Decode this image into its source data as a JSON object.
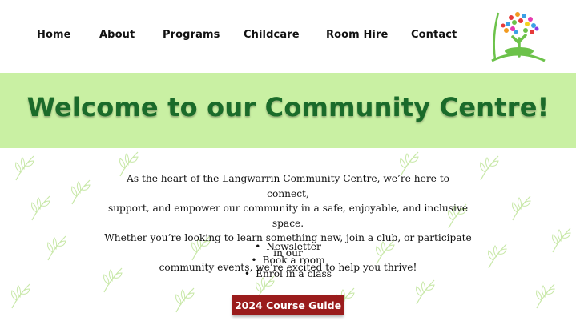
{
  "nav": {
    "items": [
      {
        "label": "Home"
      },
      {
        "label": "About"
      },
      {
        "label": "Programs"
      },
      {
        "label": "Childcare"
      },
      {
        "label": "Room Hire"
      },
      {
        "label": "Contact"
      }
    ]
  },
  "logo": {
    "icon": "tree-of-hands-logo"
  },
  "hero": {
    "title": "Welcome to our Community Centre!"
  },
  "intro": {
    "lines": [
      "As the heart of the Langwarrin Community Centre, we’re here to connect,",
      "support, and empower our community in a safe, enjoyable, and inclusive space.",
      "Whether you’re looking to learn something new, join a club, or participate in our",
      "community events, we’re excited to help you thrive!"
    ]
  },
  "links": {
    "bullet": "•",
    "items": [
      {
        "label": "Newsletter"
      },
      {
        "label": "Book a room"
      },
      {
        "label": "Enrol in a class"
      }
    ]
  },
  "cta": {
    "label": "2024 Course Guide"
  },
  "colors": {
    "hero_bg": "#c9f0a3",
    "hero_text": "#1a6b2a",
    "cta_bg": "#9a1c1c",
    "leaf_pattern": "#c8e8a8"
  }
}
